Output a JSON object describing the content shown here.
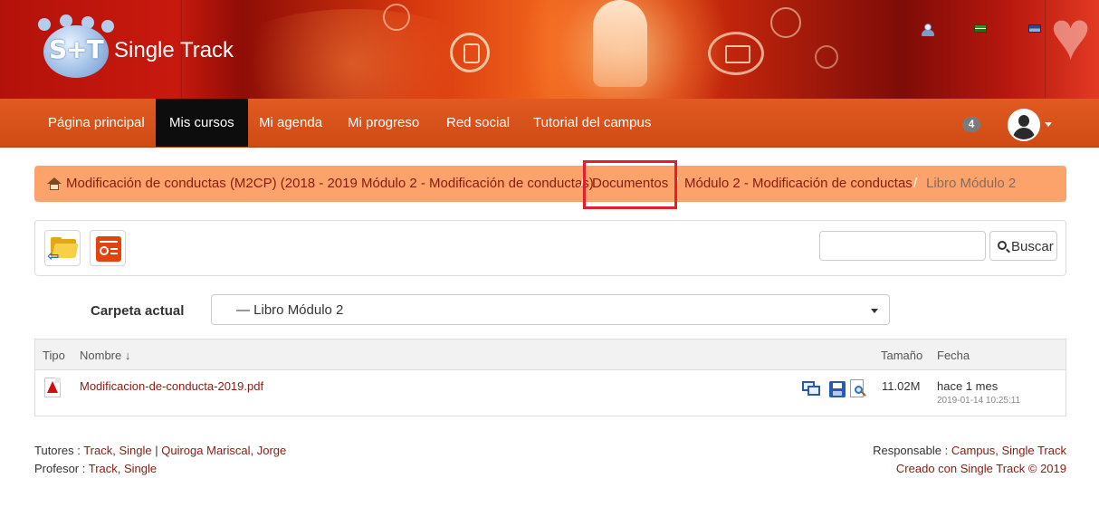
{
  "header": {
    "logo_text": "Single Track",
    "logo_mono": "S+T"
  },
  "nav": {
    "items": [
      {
        "label": "Página principal",
        "active": false
      },
      {
        "label": "Mis cursos",
        "active": true
      },
      {
        "label": "Mi agenda",
        "active": false
      },
      {
        "label": "Mi progreso",
        "active": false
      },
      {
        "label": "Red social",
        "active": false
      },
      {
        "label": "Tutorial del campus",
        "active": false
      }
    ],
    "notification_count": "4"
  },
  "breadcrumb": {
    "items": [
      "Modificación de conductas (M2CP) (2018 - 2019 Módulo 2 - Modificación de conductas)",
      "Documentos",
      "Módulo 2 - Modificación de conductas",
      "Libro Módulo 2"
    ],
    "separator": "/"
  },
  "toolbar": {
    "search_placeholder": "",
    "search_button": "Buscar"
  },
  "folder": {
    "label": "Carpeta actual",
    "selected": "— Libro Módulo 2"
  },
  "table": {
    "headers": {
      "type": "Tipo",
      "name": "Nombre ↓",
      "size": "Tamaño",
      "date": "Fecha"
    },
    "rows": [
      {
        "type_icon": "pdf-icon",
        "name": "Modificacion-de-conducta-2019.pdf",
        "size": "11.02M",
        "date_relative": "hace 1 mes",
        "date_absolute": "2019-01-14 10:25:11"
      }
    ]
  },
  "footer": {
    "tutors_label": "Tutores :",
    "tutor1": "Track, Single",
    "tutor_sep": "|",
    "tutor2": "Quiroga Mariscal, Jorge",
    "teacher_label": "Profesor :",
    "teacher": "Track, Single",
    "responsible_label": "Responsable :",
    "responsible": "Campus, Single Track",
    "created_with": "Creado con Single Track © 2019"
  },
  "colors": {
    "navbar": "#d04a14",
    "active_nav": "#0d0d0d",
    "breadcrumb_bg": "#fba36a",
    "link": "#8b1a10",
    "highlight": "#e0202c"
  }
}
